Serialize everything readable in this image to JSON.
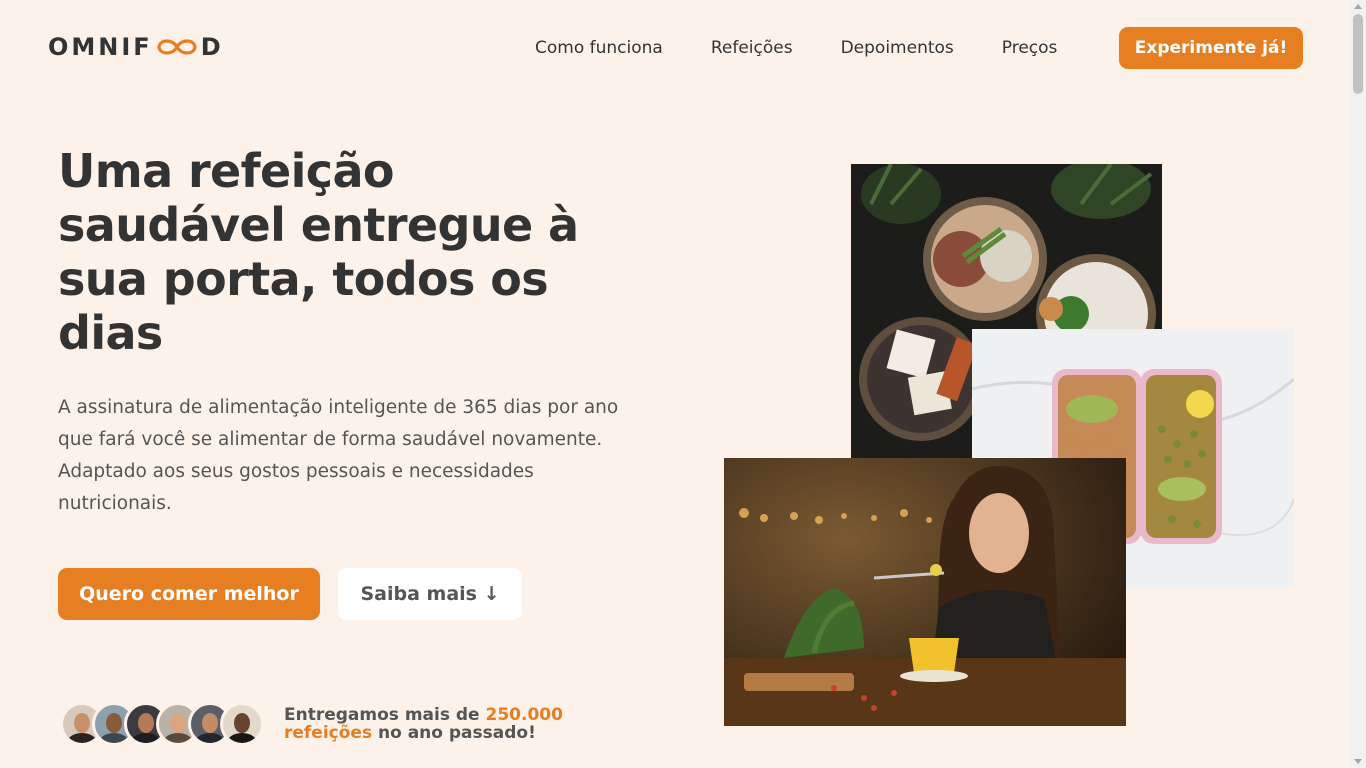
{
  "header": {
    "logo_text_left": "OMNIF",
    "logo_text_right": "D",
    "nav": [
      "Como funciona",
      "Refeições",
      "Depoimentos",
      "Preços"
    ],
    "cta": "Experimente já!"
  },
  "hero": {
    "title": "Uma refeição saudável entregue à sua porta, todos os dias",
    "description": "A assinatura de alimentação inteligente de 365 dias por ano que fará você se alimentar de forma saudável novamente. Adaptado aos seus gostos pessoais e necessidades nutricionais.",
    "primary_button": "Quero comer melhor",
    "secondary_button": "Saiba mais ↓",
    "delivered_prefix": "Entregamos mais de ",
    "delivered_highlight": "250.000 refeições",
    "delivered_suffix": " no ano passado!"
  },
  "colors": {
    "background": "#fdf2e9",
    "accent": "#e67e22",
    "text": "#333333"
  },
  "icons": [
    "infinity-logo-icon"
  ]
}
